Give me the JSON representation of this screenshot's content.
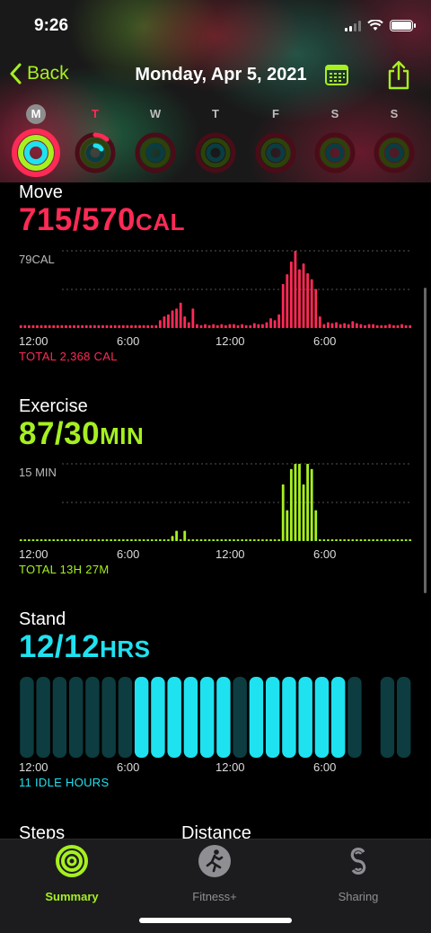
{
  "status": {
    "time": "9:26"
  },
  "nav": {
    "back_label": "Back",
    "title": "Monday, Apr 5, 2021"
  },
  "week": {
    "days": [
      "M",
      "T",
      "W",
      "T",
      "F",
      "S",
      "S"
    ]
  },
  "colors": {
    "accent": "#a6f01f",
    "move": "#ff2a55",
    "exercise": "#a6f01f",
    "stand": "#1fe2f0"
  },
  "move": {
    "title": "Move",
    "value": "715/570",
    "unit": "CAL",
    "max_label": "79CAL",
    "axis": [
      "12:00",
      "6:00",
      "12:00",
      "6:00"
    ],
    "total": "TOTAL 2,368 CAL"
  },
  "exercise": {
    "title": "Exercise",
    "value": "87/30",
    "unit": "MIN",
    "max_label": "15 MIN",
    "axis": [
      "12:00",
      "6:00",
      "12:00",
      "6:00"
    ],
    "total": "TOTAL 13H 27M"
  },
  "stand": {
    "title": "Stand",
    "value": "12/12",
    "unit": "HRS",
    "axis": [
      "12:00",
      "6:00",
      "12:00",
      "6:00"
    ],
    "total": "11 IDLE HOURS"
  },
  "cutoff": {
    "steps": "Steps",
    "distance": "Distance"
  },
  "tabs": [
    {
      "label": "Summary",
      "icon": "activity-rings-icon",
      "active": true
    },
    {
      "label": "Fitness+",
      "icon": "running-figure-icon",
      "active": false
    },
    {
      "label": "Sharing",
      "icon": "sharing-icon",
      "active": false
    }
  ],
  "chart_data": [
    {
      "type": "bar",
      "title": "Move",
      "ylabel": "CAL",
      "ylim": [
        0,
        79
      ],
      "x_ticks": [
        "12:00",
        "6:00",
        "12:00",
        "6:00"
      ],
      "bins": 96,
      "values": [
        3,
        3,
        3,
        3,
        3,
        3,
        3,
        3,
        3,
        3,
        3,
        3,
        3,
        3,
        3,
        3,
        3,
        3,
        3,
        3,
        3,
        3,
        3,
        3,
        3,
        3,
        3,
        3,
        3,
        3,
        3,
        3,
        3,
        3,
        8,
        12,
        14,
        18,
        20,
        26,
        12,
        6,
        20,
        4,
        3,
        4,
        3,
        4,
        3,
        4,
        3,
        4,
        4,
        3,
        4,
        3,
        3,
        5,
        4,
        4,
        6,
        10,
        8,
        14,
        45,
        55,
        68,
        79,
        60,
        66,
        56,
        50,
        40,
        12,
        4,
        6,
        5,
        6,
        4,
        5,
        4,
        7,
        5,
        4,
        3,
        4,
        4,
        3,
        3,
        3,
        4,
        3,
        3,
        4,
        3,
        3
      ]
    },
    {
      "type": "bar",
      "title": "Exercise",
      "ylabel": "MIN",
      "ylim": [
        0,
        15
      ],
      "x_ticks": [
        "12:00",
        "6:00",
        "12:00",
        "6:00"
      ],
      "bins": 96,
      "values": [
        0,
        0,
        0,
        0,
        0,
        0,
        0,
        0,
        0,
        0,
        0,
        0,
        0,
        0,
        0,
        0,
        0,
        0,
        0,
        0,
        0,
        0,
        0,
        0,
        0,
        0,
        0,
        0,
        0,
        0,
        0,
        0,
        0,
        0,
        0,
        0,
        0,
        1,
        2,
        0,
        2,
        0,
        0,
        0,
        0,
        0,
        0,
        0,
        0,
        0,
        0,
        0,
        0,
        0,
        0,
        0,
        0,
        0,
        0,
        0,
        0,
        0,
        0,
        0,
        11,
        6,
        14,
        15,
        15,
        11,
        15,
        14,
        6,
        0,
        0,
        0,
        0,
        0,
        0,
        0,
        0,
        0,
        0,
        0,
        0,
        0,
        0,
        0,
        0,
        0,
        0,
        0,
        0,
        0,
        0,
        0
      ]
    },
    {
      "type": "bar",
      "title": "Stand",
      "ylabel": "HRS",
      "x_ticks": [
        "12:00",
        "6:00",
        "12:00",
        "6:00"
      ],
      "bins": 24,
      "stood": [
        0,
        0,
        0,
        0,
        0,
        0,
        0,
        1,
        1,
        1,
        1,
        1,
        1,
        0,
        1,
        1,
        1,
        1,
        1,
        1,
        0,
        null,
        0,
        0
      ]
    }
  ]
}
